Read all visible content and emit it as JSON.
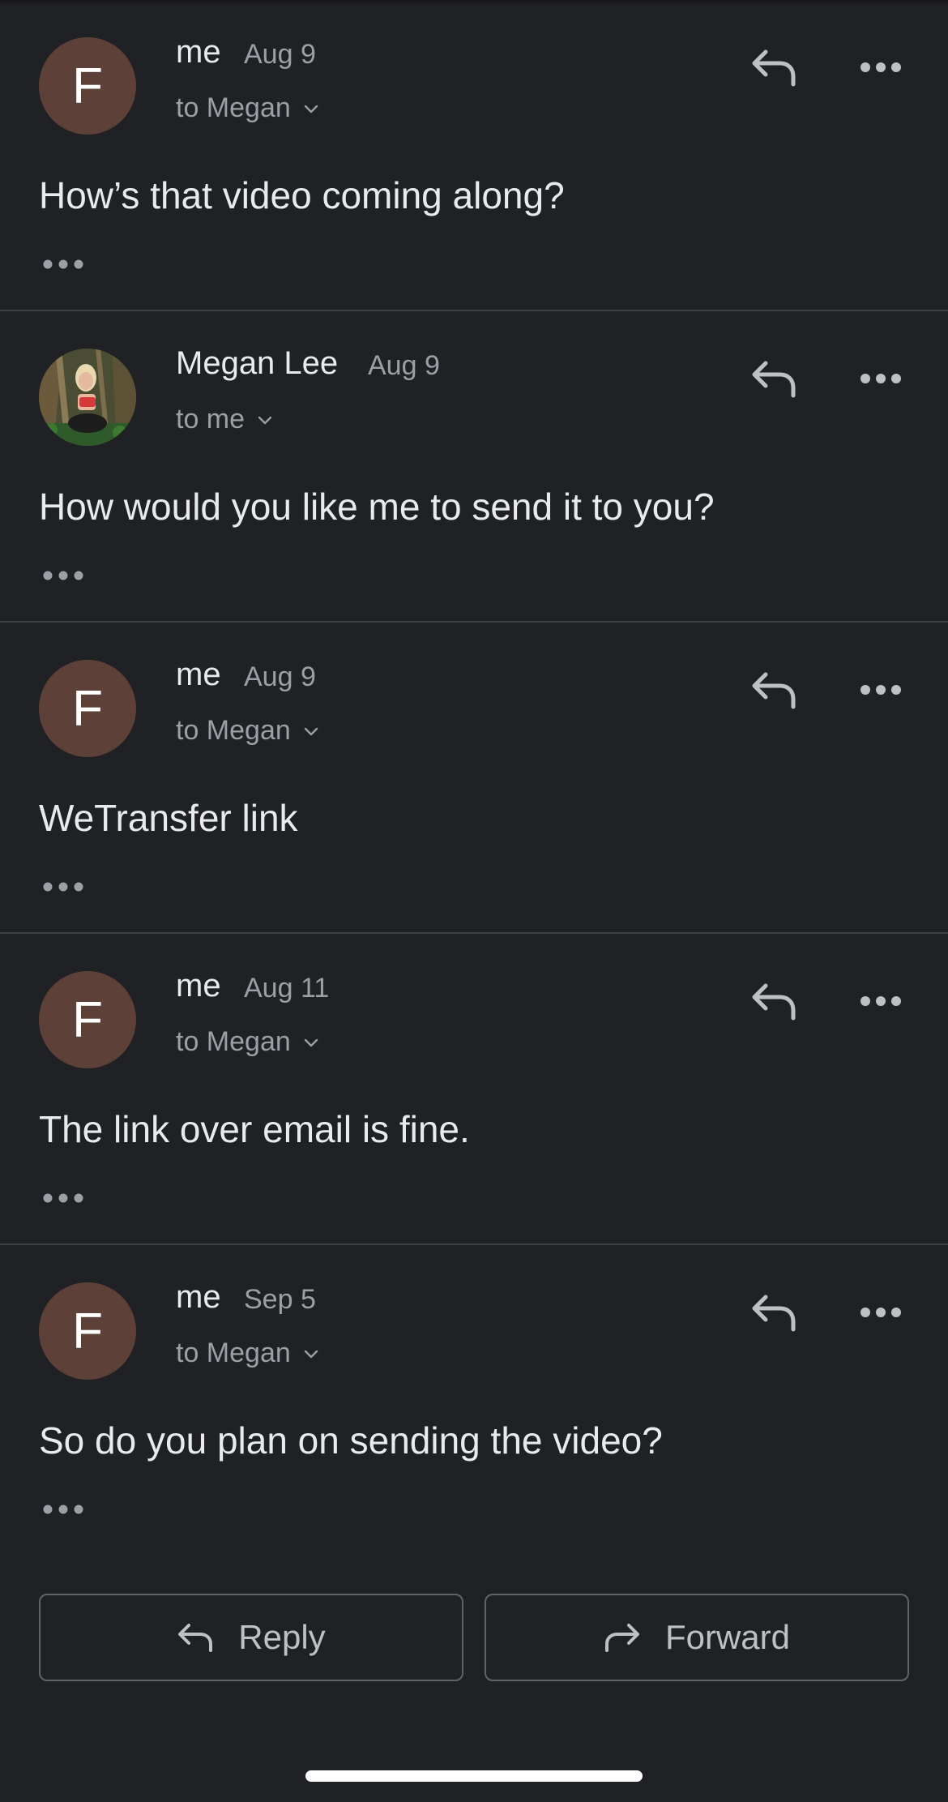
{
  "messages": [
    {
      "sender": "me",
      "date": "Aug 9",
      "recipient": "to Megan",
      "avatar_letter": "F",
      "avatar_type": "letter",
      "body": "How’s that video coming along?"
    },
    {
      "sender": "Megan Lee",
      "date": "Aug 9",
      "recipient": "to me",
      "avatar_letter": "",
      "avatar_type": "photo",
      "body": "How would you like me to send it to you?"
    },
    {
      "sender": "me",
      "date": "Aug 9",
      "recipient": "to Megan",
      "avatar_letter": "F",
      "avatar_type": "letter",
      "body": "WeTransfer link"
    },
    {
      "sender": "me",
      "date": "Aug 11",
      "recipient": "to Megan",
      "avatar_letter": "F",
      "avatar_type": "letter",
      "body": "The link over email is fine."
    },
    {
      "sender": "me",
      "date": "Sep 5",
      "recipient": "to Megan",
      "avatar_letter": "F",
      "avatar_type": "letter",
      "body": "So do you plan on sending the video?"
    }
  ],
  "actions": {
    "reply_label": "Reply",
    "forward_label": "Forward"
  },
  "colors": {
    "background": "#202124",
    "avatar_bg": "#5d4037",
    "divider": "#3c4043",
    "secondary_text": "#9aa0a6"
  },
  "icons": {
    "reply": "reply-icon",
    "more": "more-horizontal-icon",
    "chevron": "chevron-down-icon",
    "forward": "forward-icon",
    "ellipsis": "show-trimmed-content-icon"
  }
}
